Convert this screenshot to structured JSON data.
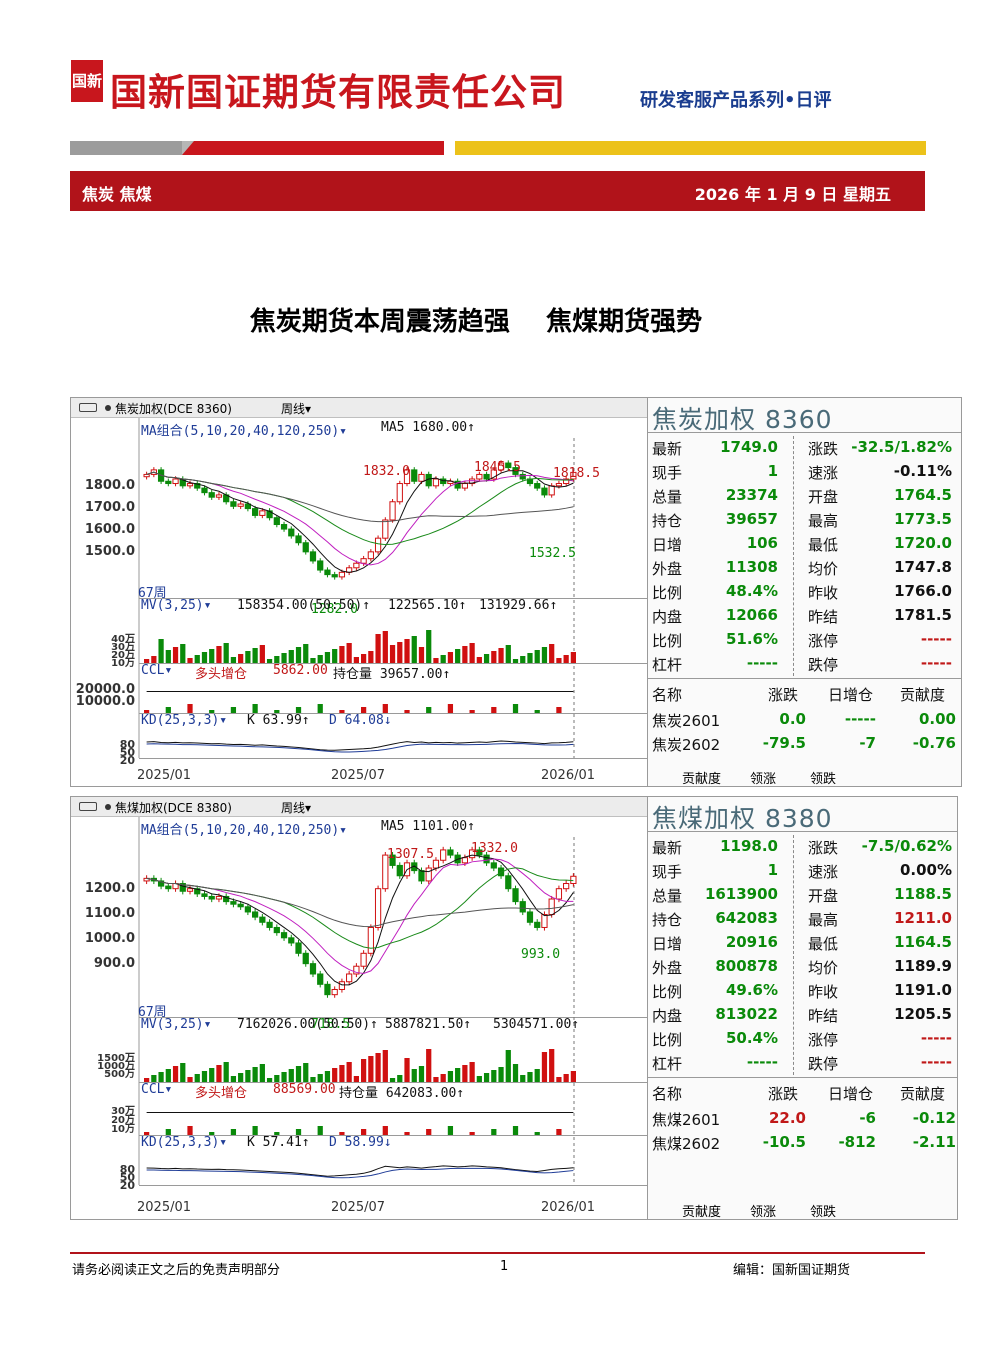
{
  "header": {
    "logo_mark": "国新",
    "company": "国新国证期货有限责任公司",
    "series": "研发客服产品系列•日评",
    "band_left": "焦炭 焦煤",
    "band_right": "2026 年 1 月 9 日    星期五"
  },
  "headline": "焦炭期货本周震荡趋强    焦煤期货强势",
  "panels": [
    {
      "toolbar_title": "焦炭加权(DCE 8360)",
      "period": "周线▾",
      "ma_label": "MA组合(5,10,20,40,120,250)▾",
      "ma5": "MA5 1680.00↑",
      "peaks": [
        "1832.0",
        "1845.5",
        "1818.5"
      ],
      "troughs": [
        "1532.5",
        "1282.0"
      ],
      "week_label": "67周",
      "mv_line": "MV(3,25)▾",
      "mv_values": [
        "158354.00(50:50)↑",
        "122565.10↑",
        "131929.66↑"
      ],
      "ccl_label": "CCL▾",
      "ccl_state": "多头增仓",
      "ccl_value": "5862.00",
      "ccl_oi": "持仓量 39657.00↑",
      "kd_label": "KD(25,3,3)▾",
      "kd_k": "K 63.99↑",
      "kd_d": "D 64.08↓",
      "y_axis": [
        "1800.0",
        "1700.0",
        "1600.0",
        "1500.0"
      ],
      "mv_axis": [
        "40万",
        "30万",
        "20万",
        "10万"
      ],
      "ccl_axis": [
        "20000.0",
        "10000.0"
      ],
      "kd_axis": [
        "80",
        "50",
        "20"
      ],
      "dates": [
        "2025/01",
        "2025/07",
        "2026/01"
      ],
      "quote_title": "焦炭加权  8360",
      "rows": [
        [
          "最新",
          "1749.0",
          "涨跌",
          "-32.5/1.82%"
        ],
        [
          "现手",
          "1",
          "速涨",
          "-0.11%"
        ],
        [
          "总量",
          "23374",
          "开盘",
          "1764.5"
        ],
        [
          "持仓",
          "39657",
          "最高",
          "1773.5"
        ],
        [
          "日增",
          "106",
          "最低",
          "1720.0"
        ],
        [
          "外盘",
          "11308",
          "均价",
          "1747.8"
        ],
        [
          "比例",
          "48.4%",
          "昨收",
          "1766.0"
        ],
        [
          "内盘",
          "12066",
          "昨结",
          "1781.5"
        ],
        [
          "比例",
          "51.6%",
          "涨停",
          "-----"
        ],
        [
          "杠杆",
          "-----",
          "跌停",
          "-----"
        ]
      ],
      "contracts_header": [
        "名称",
        "涨跌",
        "日增仓",
        "贡献度"
      ],
      "contracts": [
        [
          "焦炭2601",
          "0.0",
          "-----",
          "0.00"
        ],
        [
          "焦炭2602",
          "-79.5",
          "-7",
          "-0.76"
        ]
      ],
      "tabs": [
        "贡献度",
        "领涨",
        "领跌"
      ],
      "chart_data": {
        "type": "candlestick",
        "ylim": [
          1250,
          1900
        ],
        "close": [
          1740,
          1760,
          1710,
          1700,
          1720,
          1690,
          1700,
          1680,
          1660,
          1640,
          1650,
          1620,
          1600,
          1610,
          1590,
          1560,
          1580,
          1550,
          1520,
          1500,
          1470,
          1440,
          1400,
          1360,
          1320,
          1300,
          1290,
          1310,
          1330,
          1350,
          1370,
          1400,
          1460,
          1540,
          1620,
          1700,
          1760,
          1710,
          1740,
          1690,
          1720,
          1700,
          1710,
          1680,
          1700,
          1720,
          1740,
          1720,
          1760,
          1790,
          1770,
          1740,
          1720,
          1700,
          1680,
          1650,
          1690,
          1700,
          1720,
          1749
        ]
      }
    },
    {
      "toolbar_title": "焦煤加权(DCE 8380)",
      "period": "周线▾",
      "ma_label": "MA组合(5,10,20,40,120,250)▾",
      "ma5": "MA5 1101.00↑",
      "peaks": [
        "1307.5",
        "1332.0"
      ],
      "troughs": [
        "993.0",
        "718.5"
      ],
      "week_label": "67周",
      "mv_line": "MV(3,25)▾",
      "mv_values": [
        "7162026.00(50:50)↑",
        "5887821.50↑",
        "5304571.00↑"
      ],
      "ccl_label": "CCL▾",
      "ccl_state": "多头增仓",
      "ccl_value": "88569.00",
      "ccl_oi": "持仓量 642083.00↑",
      "kd_label": "KD(25,3,3)▾",
      "kd_k": "K 57.41↑",
      "kd_d": "D 58.99↓",
      "y_axis": [
        "1200.0",
        "1100.0",
        "1000.0",
        "900.0"
      ],
      "mv_axis": [
        "1500万",
        "1000万",
        "500万"
      ],
      "ccl_axis": [
        "30万",
        "20万",
        "10万"
      ],
      "kd_axis": [
        "80",
        "50",
        "20"
      ],
      "dates": [
        "2025/01",
        "2025/07",
        "2026/01"
      ],
      "quote_title": "焦煤加权  8380",
      "rows": [
        [
          "最新",
          "1198.0",
          "涨跌",
          "-7.5/0.62%"
        ],
        [
          "现手",
          "1",
          "速涨",
          "0.00%"
        ],
        [
          "总量",
          "1613900",
          "开盘",
          "1188.5"
        ],
        [
          "持仓",
          "642083",
          "最高",
          "1211.0"
        ],
        [
          "日增",
          "20916",
          "最低",
          "1164.5"
        ],
        [
          "外盘",
          "800878",
          "均价",
          "1189.9"
        ],
        [
          "比例",
          "49.6%",
          "昨收",
          "1191.0"
        ],
        [
          "内盘",
          "813022",
          "昨结",
          "1205.5"
        ],
        [
          "比例",
          "50.4%",
          "涨停",
          "-----"
        ],
        [
          "杠杆",
          "-----",
          "跌停",
          "-----"
        ]
      ],
      "contracts_header": [
        "名称",
        "涨跌",
        "日增仓",
        "贡献度"
      ],
      "contracts": [
        [
          "焦煤2601",
          "22.0",
          "-6",
          "-0.12"
        ],
        [
          "焦煤2602",
          "-10.5",
          "-812",
          "-2.11"
        ]
      ],
      "tabs": [
        "贡献度",
        "领涨",
        "领跌"
      ],
      "chart_data": {
        "type": "candlestick",
        "ylim": [
          700,
          1350
        ],
        "close": [
          1190,
          1180,
          1160,
          1150,
          1170,
          1140,
          1150,
          1130,
          1120,
          1110,
          1120,
          1100,
          1090,
          1080,
          1060,
          1040,
          1020,
          1000,
          980,
          960,
          940,
          900,
          860,
          820,
          780,
          740,
          760,
          790,
          820,
          850,
          900,
          1000,
          1150,
          1280,
          1240,
          1200,
          1250,
          1220,
          1180,
          1230,
          1260,
          1300,
          1280,
          1250,
          1270,
          1300,
          1280,
          1250,
          1230,
          1200,
          1150,
          1100,
          1060,
          1020,
          1000,
          1050,
          1110,
          1150,
          1170,
          1198
        ]
      }
    }
  ],
  "footer": {
    "left": "请务必阅读正文之后的免责声明部分",
    "page": "1",
    "right": "编辑：国新国证期货"
  }
}
